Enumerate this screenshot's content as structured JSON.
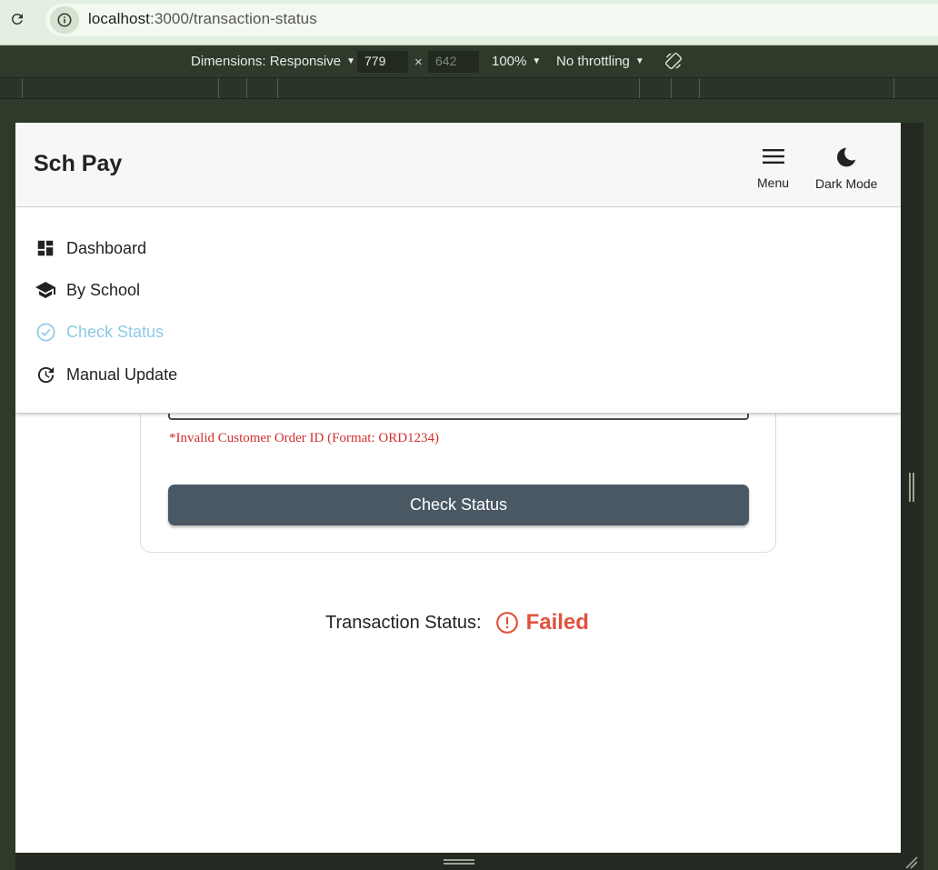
{
  "browser": {
    "url_host": "localhost",
    "url_path": ":3000/transaction-status"
  },
  "devtools": {
    "dimensions_label": "Dimensions: Responsive",
    "width": "779",
    "height": "642",
    "zoom": "100%",
    "throttling": "No throttling"
  },
  "app": {
    "brand": "Sch Pay",
    "menu_label": "Menu",
    "dark_mode_label": "Dark Mode"
  },
  "nav": {
    "items": [
      {
        "label": "Dashboard",
        "icon": "dashboard-icon"
      },
      {
        "label": "By School",
        "icon": "school-icon"
      },
      {
        "label": "Check Status",
        "icon": "check-circle-icon",
        "active": true
      },
      {
        "label": "Manual Update",
        "icon": "history-icon"
      }
    ]
  },
  "form": {
    "error_text": "*Invalid Customer Order ID (Format: ORD1234)",
    "check_button_label": "Check Status"
  },
  "status": {
    "label": "Transaction Status:",
    "value": "Failed"
  },
  "colors": {
    "active_nav": "#8ecae6",
    "failed": "#e0523e",
    "button": "#4a5863",
    "error": "#d32f2f"
  }
}
